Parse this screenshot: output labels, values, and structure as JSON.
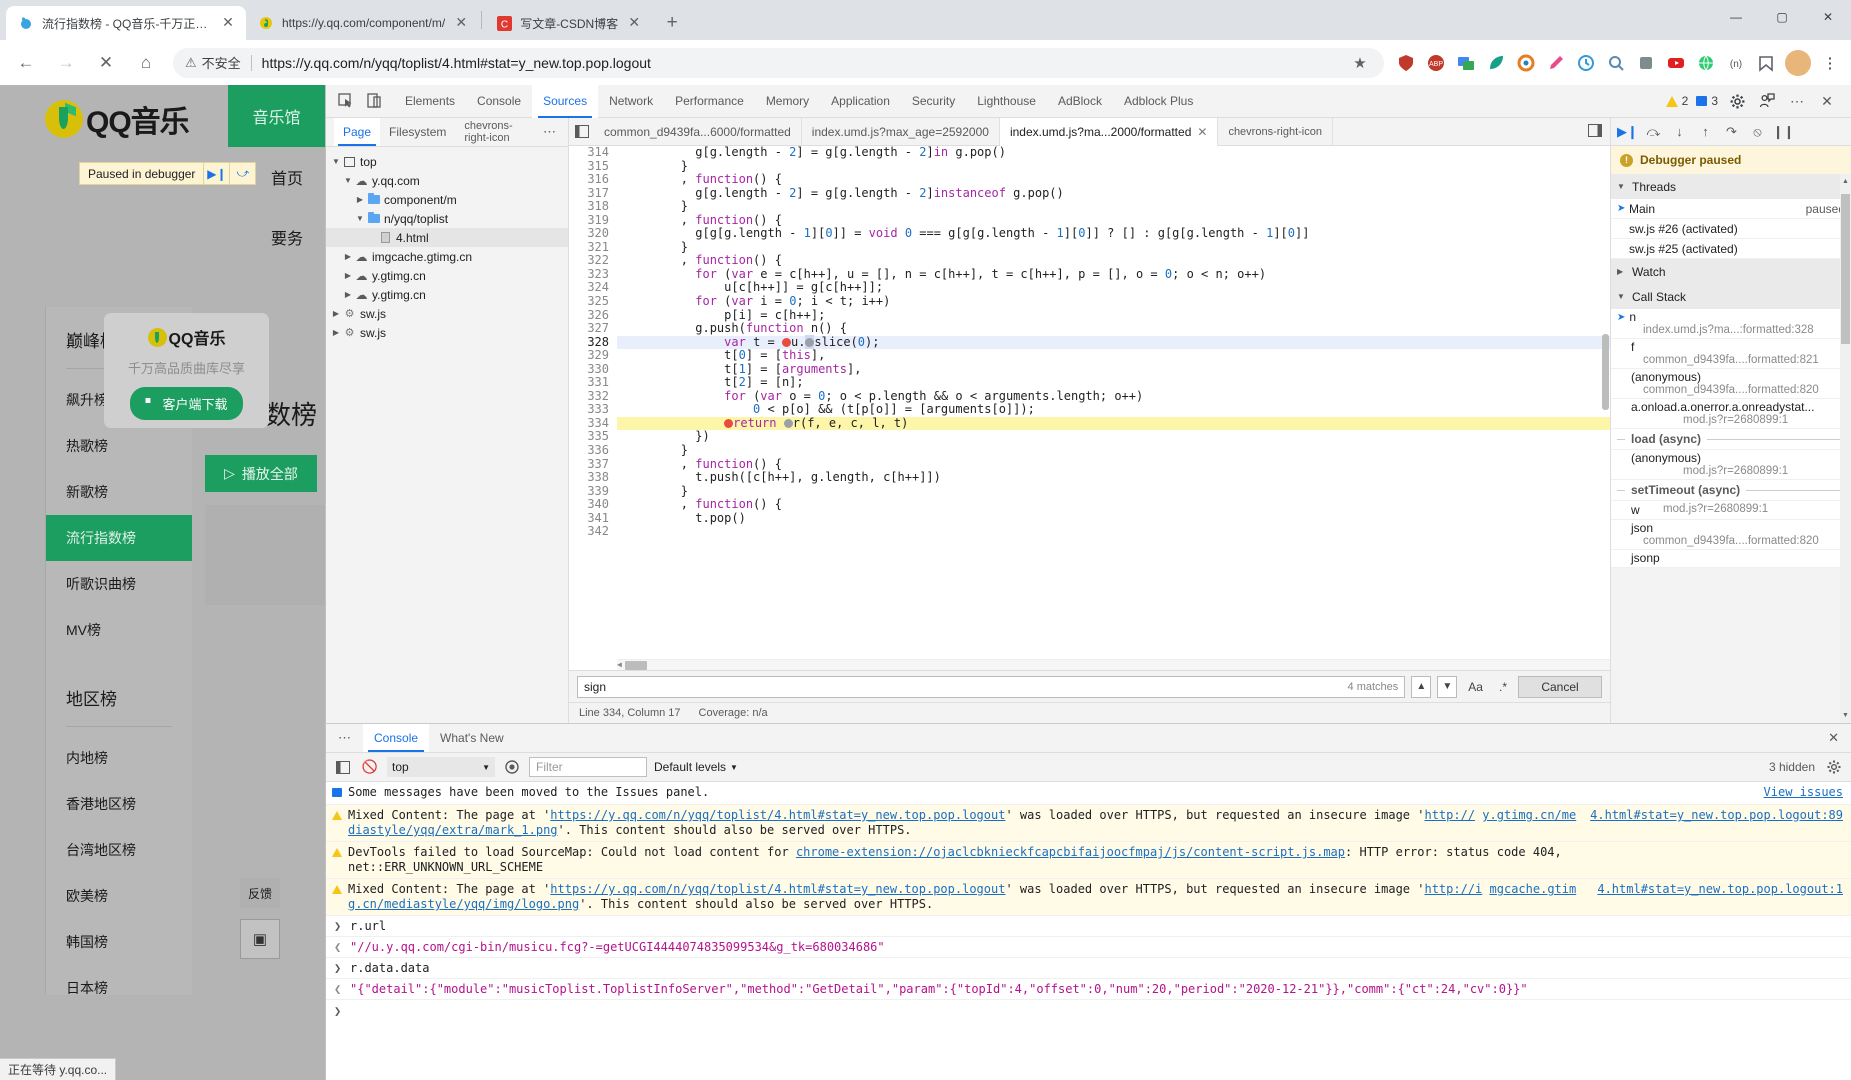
{
  "browser": {
    "tabs": [
      {
        "title": "流行指数榜 - QQ音乐-千万正版音",
        "favicon": "qqmusic-icon",
        "active": true
      },
      {
        "title": "https://y.qq.com/component/m/",
        "favicon": "qqmusic-icon",
        "active": false
      },
      {
        "title": "写文章-CSDN博客",
        "favicon": "csdn-icon",
        "active": false
      }
    ],
    "newtab_label": "+",
    "window_controls": {
      "minimize": "—",
      "maximize": "▢",
      "close": "✕"
    },
    "nav": {
      "back": "←",
      "forward": "→",
      "stop": "✕",
      "home": "⌂"
    },
    "omnibox": {
      "security_label": "不安全",
      "security_icon": "warning-triangle-icon",
      "url": "https://y.qq.com/n/yqq/toplist/4.html#stat=y_new.top.pop.logout",
      "star_icon": "★"
    },
    "extensions": [
      "shield-icon",
      "abp-icon",
      "translate-icon",
      "leaf-icon",
      "target-icon",
      "eyedropper-icon",
      "clock-icon",
      "search-ext-icon",
      "puzzle-icon",
      "youtube-icon",
      "globe-icon",
      "network-icon",
      "bookmark-icon",
      "profile-avatar",
      "menu-dots-icon"
    ]
  },
  "qqmusic": {
    "brand": "QQ音乐",
    "music_hall": "音乐馆",
    "nav": [
      "首页",
      "要务"
    ],
    "paused_banner": {
      "text": "Paused in debugger",
      "resume_icon": "resume-icon",
      "step-over_icon": "step-over-icon"
    },
    "download_popup": {
      "brand": "QQ音乐",
      "tagline": "千万高品质曲库尽享",
      "button": "客户端下载",
      "button_icon": "windows-icon"
    },
    "list_title": "巅峰榜",
    "items": [
      {
        "label": "飙升榜",
        "selected": false
      },
      {
        "label": "热歌榜",
        "selected": false
      },
      {
        "label": "新歌榜",
        "selected": false
      },
      {
        "label": "流行指数榜",
        "selected": true
      },
      {
        "label": "听歌识曲榜",
        "selected": false
      },
      {
        "label": "MV榜",
        "selected": false
      }
    ],
    "region_title": "地区榜",
    "region_items": [
      "内地榜",
      "香港地区榜",
      "台湾地区榜",
      "欧美榜",
      "韩国榜",
      "日本榜"
    ],
    "big_title": "数榜",
    "play_all": "播放全部",
    "play_icon": "play-triangle-icon",
    "feedback": "反馈",
    "side_tool_icon": "panel-icon",
    "status_text": "正在等待 y.qq.co..."
  },
  "devtools": {
    "toolbar": {
      "inspect_icon": "inspect-cursor-icon",
      "device_icon": "device-toolbar-icon",
      "tabs": [
        "Elements",
        "Console",
        "Sources",
        "Network",
        "Performance",
        "Memory",
        "Application",
        "Security",
        "Lighthouse",
        "AdBlock",
        "Adblock Plus"
      ],
      "active_tab": "Sources",
      "warning_count": "2",
      "info_count": "3",
      "settings_icon": "gear-icon",
      "account_icon": "person-feedback-icon",
      "more_icon": "more-dots-icon",
      "close_icon": "close-icon"
    },
    "navigator": {
      "tabs": [
        "Page",
        "Filesystem"
      ],
      "active_tab": "Page",
      "overflow_icon": "chevrons-right-icon",
      "more_icon": "more-dots-icon",
      "tree": [
        {
          "label": "top",
          "icon": "frame-icon",
          "depth": 0,
          "twisty": "▼",
          "selected": false
        },
        {
          "label": "y.qq.com",
          "icon": "cloud-icon",
          "depth": 1,
          "twisty": "▼",
          "selected": false
        },
        {
          "label": "component/m",
          "icon": "folder-icon",
          "depth": 2,
          "twisty": "▶",
          "selected": false
        },
        {
          "label": "n/yqq/toplist",
          "icon": "folder-icon",
          "depth": 2,
          "twisty": "▼",
          "selected": false
        },
        {
          "label": "4.html",
          "icon": "file-icon",
          "depth": 3,
          "twisty": "",
          "selected": true
        },
        {
          "label": "imgcache.gtimg.cn",
          "icon": "cloud-icon",
          "depth": 1,
          "twisty": "▶",
          "selected": false
        },
        {
          "label": "y.gtimg.cn",
          "icon": "cloud-icon",
          "depth": 1,
          "twisty": "▶",
          "selected": false
        },
        {
          "label": "y.gtimg.cn",
          "icon": "cloud-icon",
          "depth": 1,
          "twisty": "▶",
          "selected": false
        },
        {
          "label": "sw.js",
          "icon": "gear-icon",
          "depth": 0,
          "twisty": "▶",
          "selected": false
        },
        {
          "label": "sw.js",
          "icon": "gear-icon",
          "depth": 0,
          "twisty": "▶",
          "selected": false
        }
      ]
    },
    "editor": {
      "tabs": [
        {
          "label": "common_d9439fa...6000/formatted",
          "active": false,
          "closable": false
        },
        {
          "label": "index.umd.js?max_age=2592000",
          "active": false,
          "closable": false
        },
        {
          "label": "index.umd.js?ma...2000/formatted",
          "active": true,
          "closable": true
        }
      ],
      "overflow_icon": "chevrons-right-icon",
      "panel_icon": "show-navigator-icon",
      "right_icon": "open-drawer-icon",
      "status": {
        "position": "Line 334, Column 17",
        "coverage": "Coverage: n/a"
      },
      "lines": [
        {
          "num": "314",
          "text": "          g[g.length - 2] = g[g.length - 2]in g.pop()",
          "state": "",
          "bp": false
        },
        {
          "num": "315",
          "text": "        }",
          "state": "",
          "bp": false
        },
        {
          "num": "316",
          "text": "        , function() {",
          "state": "",
          "bp": false
        },
        {
          "num": "317",
          "text": "          g[g.length - 2] = g[g.length - 2]instanceof g.pop()",
          "state": "",
          "bp": false
        },
        {
          "num": "318",
          "text": "        }",
          "state": "",
          "bp": false
        },
        {
          "num": "319",
          "text": "        , function() {",
          "state": "",
          "bp": false
        },
        {
          "num": "320",
          "text": "          g[g[g.length - 1][0]] = void 0 === g[g[g.length - 1][0]] ? [] : g[g[g.length - 1][0]]",
          "state": "",
          "bp": false
        },
        {
          "num": "321",
          "text": "        }",
          "state": "",
          "bp": false
        },
        {
          "num": "322",
          "text": "        , function() {",
          "state": "",
          "bp": false
        },
        {
          "num": "323",
          "text": "          for (var e = c[h++], u = [], n = c[h++], t = c[h++], p = [], o = 0; o < n; o++)",
          "state": "",
          "bp": false
        },
        {
          "num": "324",
          "text": "              u[c[h++]] = g[c[h++]];",
          "state": "",
          "bp": false
        },
        {
          "num": "325",
          "text": "          for (var i = 0; i < t; i++)",
          "state": "",
          "bp": false
        },
        {
          "num": "326",
          "text": "              p[i] = c[h++];",
          "state": "",
          "bp": false
        },
        {
          "num": "327",
          "text": "          g.push(function n() {",
          "state": "",
          "bp": false
        },
        {
          "num": "328",
          "text": "              var t = u.slice(0);",
          "state": "executing",
          "bp": true
        },
        {
          "num": "329",
          "text": "              t[0] = [this],",
          "state": "",
          "bp": false
        },
        {
          "num": "330",
          "text": "              t[1] = [arguments],",
          "state": "",
          "bp": false
        },
        {
          "num": "331",
          "text": "              t[2] = [n];",
          "state": "",
          "bp": false
        },
        {
          "num": "332",
          "text": "              for (var o = 0; o < p.length && o < arguments.length; o++)",
          "state": "",
          "bp": false
        },
        {
          "num": "333",
          "text": "                  0 < p[o] && (t[p[o]] = [arguments[o]]);",
          "state": "",
          "bp": false
        },
        {
          "num": "334",
          "text": "              return r(f, e, c, l, t)",
          "state": "breakpoint",
          "bp": true
        },
        {
          "num": "335",
          "text": "          })",
          "state": "",
          "bp": false
        },
        {
          "num": "336",
          "text": "        }",
          "state": "",
          "bp": false
        },
        {
          "num": "337",
          "text": "        , function() {",
          "state": "",
          "bp": false
        },
        {
          "num": "338",
          "text": "          t.push([c[h++], g.length, c[h++]])",
          "state": "",
          "bp": false
        },
        {
          "num": "339",
          "text": "        }",
          "state": "",
          "bp": false
        },
        {
          "num": "340",
          "text": "        , function() {",
          "state": "",
          "bp": false
        },
        {
          "num": "341",
          "text": "          t.pop()",
          "state": "",
          "bp": false
        },
        {
          "num": "342",
          "text": "",
          "state": "",
          "bp": false
        }
      ]
    },
    "find": {
      "query": "sign",
      "matches": "4 matches",
      "prev_icon": "▲",
      "next_icon": "▼",
      "match_case": "Aa",
      "regex": ".*",
      "cancel": "Cancel"
    },
    "debugger": {
      "controls": [
        "resume-icon",
        "step-over-icon",
        "step-into-icon",
        "step-out-icon",
        "step-icon",
        "deactivate-breakpoints-icon",
        "pause-on-exceptions-icon"
      ],
      "paused_label": "Debugger paused",
      "sections": {
        "threads": {
          "label": "Threads",
          "expanded": true
        },
        "watch": {
          "label": "Watch",
          "expanded": false
        },
        "callstack": {
          "label": "Call Stack",
          "expanded": true
        }
      },
      "threads": [
        {
          "label": "Main",
          "status": "paused",
          "selected": true
        },
        {
          "label": "sw.js #26 (activated)",
          "status": "",
          "selected": false
        },
        {
          "label": "sw.js #25 (activated)",
          "status": "",
          "selected": false
        }
      ],
      "call_stack": [
        {
          "type": "frame",
          "name": "n",
          "location": "index.umd.js?ma...:formatted:328",
          "selected": true
        },
        {
          "type": "frame",
          "name": "f",
          "location": "common_d9439fa....formatted:821",
          "selected": false
        },
        {
          "type": "frame",
          "name": "(anonymous)",
          "location": "common_d9439fa....formatted:820",
          "selected": false
        },
        {
          "type": "frame",
          "name": "a.onload.a.onerror.a.onreadystat...",
          "location": "mod.js?r=2680899:1",
          "selected": false
        },
        {
          "type": "async",
          "name": "load (async)"
        },
        {
          "type": "frame",
          "name": "(anonymous)",
          "location": "mod.js?r=2680899:1",
          "selected": false
        },
        {
          "type": "async",
          "name": "setTimeout (async)"
        },
        {
          "type": "inline",
          "name": "w",
          "location": "mod.js?r=2680899:1"
        },
        {
          "type": "frame",
          "name": "json",
          "location": "common_d9439fa....formatted:820",
          "selected": false
        },
        {
          "type": "frame",
          "name": "jsonp",
          "location": "",
          "selected": false
        }
      ]
    },
    "console": {
      "tabs": [
        "Console",
        "What's New"
      ],
      "active_tab": "Console",
      "more_icon": "more-dots-icon",
      "close_icon": "close-icon",
      "toolbar": {
        "sidebar_icon": "show-console-sidebar-icon",
        "clear_icon": "clear-console-icon",
        "context": "top",
        "eye_icon": "live-expression-icon",
        "filter_placeholder": "Filter",
        "levels": "Default levels",
        "hidden_count": "3 hidden",
        "settings_icon": "gear-icon"
      },
      "view_issues": "View issues",
      "messages": [
        {
          "level": "info",
          "icon": "info-square-icon",
          "text": "Some messages have been moved to the Issues panel.",
          "right": ""
        },
        {
          "level": "warning",
          "icon": "warning-triangle-icon",
          "text_parts": [
            {
              "t": "Mixed Content: The page at '",
              "link": false
            },
            {
              "t": "https://y.qq.com/n/yqq/toplist/4.html#stat=y_new.top.pop.logout",
              "link": true
            },
            {
              "t": "' was loaded over HTTPS, but requested an insecure image '",
              "link": false
            },
            {
              "t": "http://",
              "link": true
            },
            {
              "t": "y.gtimg.cn/mediastyle/yqq/extra/mark_1.png",
              "link": true
            },
            {
              "t": "'. This content should also be served over HTTPS.",
              "link": false
            }
          ],
          "right": "4.html#stat=y_new.top.pop.logout:89"
        },
        {
          "level": "warning",
          "icon": "warning-triangle-icon",
          "text_parts": [
            {
              "t": "DevTools failed to load SourceMap: Could not load content for ",
              "link": false
            },
            {
              "t": "chrome-extension://ojaclcbknieckfcapcbifaijoocfmpaj/js/content-script.js.map",
              "link": true
            },
            {
              "t": ": HTTP error: status code 404, net::ERR_UNKNOWN_URL_SCHEME",
              "link": false
            }
          ],
          "right": ""
        },
        {
          "level": "warning",
          "icon": "warning-triangle-icon",
          "text_parts": [
            {
              "t": "Mixed Content: The page at '",
              "link": false
            },
            {
              "t": "https://y.qq.com/n/yqq/toplist/4.html#stat=y_new.top.pop.logout",
              "link": true
            },
            {
              "t": "' was loaded over HTTPS, but requested an insecure image '",
              "link": false
            },
            {
              "t": "http://i",
              "link": true
            },
            {
              "t": "mgcache.gtimg.cn/mediastyle/yqq/img/logo.png",
              "link": true
            },
            {
              "t": "'. This content should also be served over HTTPS.",
              "link": false
            }
          ],
          "right": "4.html#stat=y_new.top.pop.logout:1"
        }
      ],
      "evaluations": [
        {
          "kind": "input",
          "caret": "❯",
          "text": "r.url"
        },
        {
          "kind": "output",
          "caret": "❮",
          "text": "\"//u.y.qq.com/cgi-bin/musicu.fcg?-=getUCGI4444074835099534&g_tk=680034686\""
        },
        {
          "kind": "input",
          "caret": "❯",
          "text": "r.data.data"
        },
        {
          "kind": "output",
          "caret": "❮",
          "text": "\"{\"detail\":{\"module\":\"musicToplist.ToplistInfoServer\",\"method\":\"GetDetail\",\"param\":{\"topId\":4,\"offset\":0,\"num\":20,\"period\":\"2020-12-21\"}},\"comm\":{\"ct\":24,\"cv\":0}}\""
        },
        {
          "kind": "prompt",
          "caret": "❯",
          "text": ""
        }
      ]
    }
  }
}
